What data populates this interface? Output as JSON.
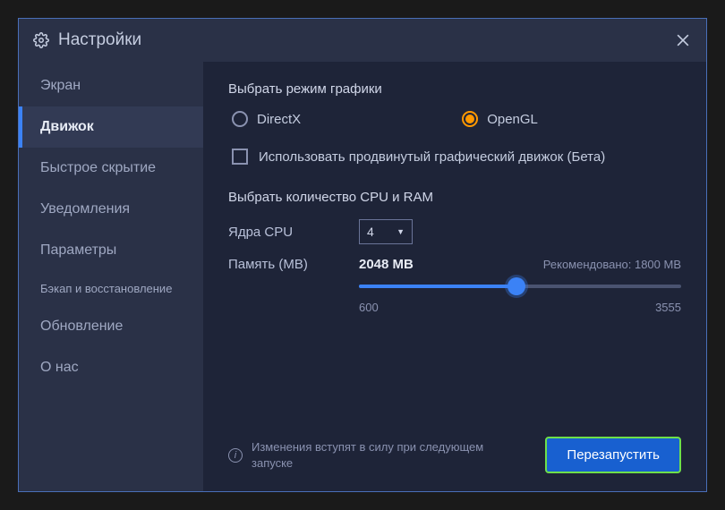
{
  "window": {
    "title": "Настройки"
  },
  "sidebar": {
    "items": [
      {
        "label": "Экран"
      },
      {
        "label": "Движок"
      },
      {
        "label": "Быстрое скрытие"
      },
      {
        "label": "Уведомления"
      },
      {
        "label": "Параметры"
      },
      {
        "label": "Бэкап и восстановление"
      },
      {
        "label": "Обновление"
      },
      {
        "label": "О нас"
      }
    ],
    "active_index": 1
  },
  "main": {
    "graphics_mode_title": "Выбрать режим графики",
    "radio_directx": "DirectX",
    "radio_opengl": "OpenGL",
    "selected_graphics": "OpenGL",
    "advanced_engine_label": "Использовать продвинутый графический движок (Бета)",
    "advanced_engine_checked": false,
    "cpu_ram_title": "Выбрать количество CPU и RAM",
    "cpu_label": "Ядра CPU",
    "cpu_value": "4",
    "memory_label": "Память (MB)",
    "memory_value_display": "2048 MB",
    "memory_recommended": "Рекомендовано: 1800 MB",
    "slider": {
      "min": 600,
      "max": 3555,
      "value": 2048,
      "min_label": "600",
      "max_label": "3555"
    }
  },
  "footer": {
    "info_text": "Изменения вступят в силу при следующем запуске",
    "restart_label": "Перезапустить"
  },
  "icons": {
    "gear": "gear-icon",
    "close": "close-icon",
    "info": "info-icon"
  },
  "colors": {
    "accent_blue": "#3b82f6",
    "accent_orange": "#ff9800",
    "button_border_green": "#6ee04a",
    "button_bg": "#1860d0",
    "panel_bg": "#1e2438",
    "sidebar_bg": "#2a3147"
  }
}
